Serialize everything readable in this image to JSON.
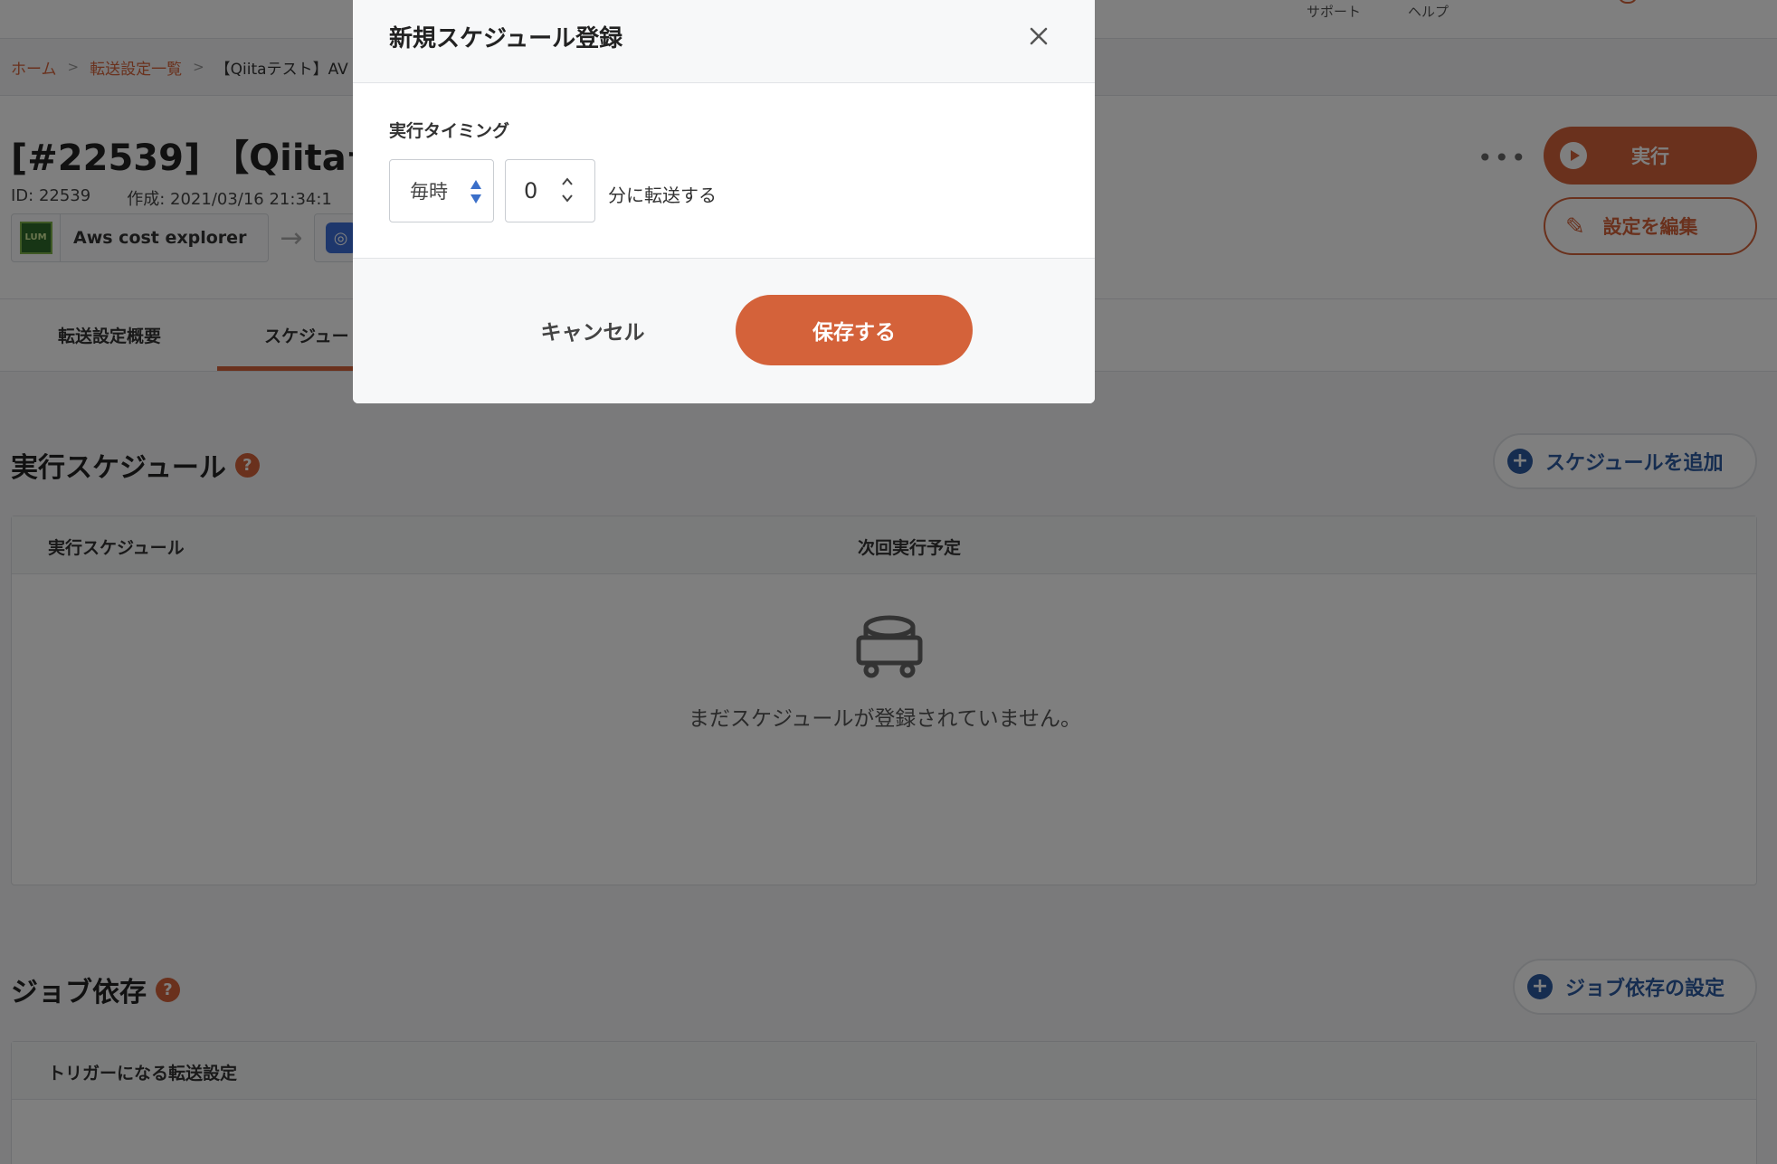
{
  "topbar": {
    "support": "サポート",
    "help": "ヘルプ"
  },
  "breadcrumb": {
    "home": "ホーム",
    "list": "転送設定一覧",
    "current": "【Qiitaテスト】AV"
  },
  "header": {
    "title": "[#22539] 【Qiitaテス",
    "id_text": "ID: 22539",
    "created_text": "作成: 2021/03/16 21:34:1",
    "source_name": "Aws cost explorer",
    "source_logo_text": "LUM",
    "run_label": "実行",
    "edit_label": "設定を編集"
  },
  "tabs": {
    "overview": "転送設定概要",
    "schedule": "スケジュー"
  },
  "schedule_section": {
    "title": "実行スケジュール",
    "add_label": "スケジュールを追加",
    "col_schedule": "実行スケジュール",
    "col_next": "次回実行予定",
    "empty_text": "まだスケジュールが登録されていません。"
  },
  "dependency_section": {
    "title": "ジョブ依存",
    "settings_label": "ジョブ依存の設定",
    "col_trigger": "トリガーになる転送設定"
  },
  "modal": {
    "title": "新規スケジュール登録",
    "timing_label": "実行タイミング",
    "frequency_value": "毎時",
    "minute_value": "0",
    "suffix": "分に転送する",
    "cancel_label": "キャンセル",
    "save_label": "保存する"
  },
  "colors": {
    "accent": "#d4623a",
    "link_blue": "#2c5aa0"
  }
}
